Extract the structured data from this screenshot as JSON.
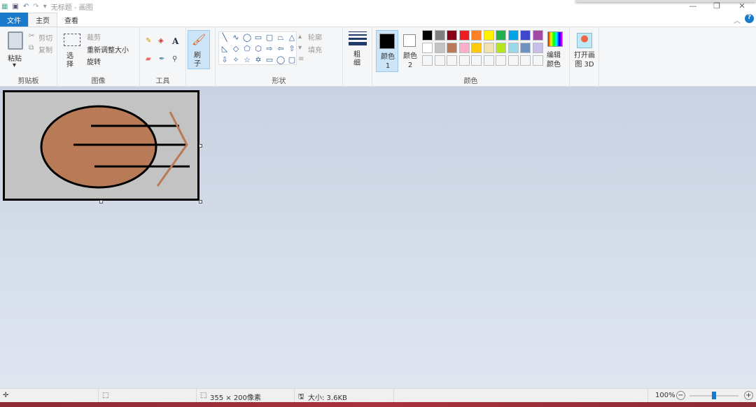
{
  "titlebar": {
    "title": "无标题 - 画图",
    "icons": [
      "paint-app-icon",
      "save-icon",
      "undo-icon",
      "redo-icon",
      "customize-dropdown-icon"
    ]
  },
  "window_controls": {
    "minimize": "—",
    "restore": "❐",
    "close": "✕"
  },
  "tabs": [
    {
      "label": "文件"
    },
    {
      "label": "主页"
    },
    {
      "label": "查看"
    }
  ],
  "ribbon": {
    "clipboard": {
      "label": "剪贴板",
      "paste": "粘贴",
      "cut": "剪切",
      "copy": "复制"
    },
    "image": {
      "label": "图像",
      "select": "选择",
      "crop": "裁剪",
      "resize": "重新调整大小",
      "rotate": "旋转"
    },
    "tools": {
      "label": "工具"
    },
    "brush": {
      "label": "刷子"
    },
    "shapes": {
      "label": "形状",
      "outline": "轮廓",
      "fill": "填充",
      "glyphs": [
        "╲",
        "∿",
        "◯",
        "▭",
        "▢",
        "⏢",
        "△",
        "◺",
        "◇",
        "⬠",
        "⬡",
        "⇨",
        "⇦",
        "⇧",
        "⇩",
        "✧",
        "☆",
        "✡",
        "▭",
        "◯",
        "▢"
      ]
    },
    "size": {
      "label": "粗细"
    },
    "colors": {
      "label": "颜色",
      "color1": "颜色 1",
      "color2": "颜色 2",
      "edit": "编辑颜色",
      "color1_value": "#000000",
      "color2_value": "#ffffff",
      "palette_row1": [
        "#000000",
        "#7f7f7f",
        "#880015",
        "#ed1c24",
        "#ff7f27",
        "#fff200",
        "#22b14c",
        "#00a2e8",
        "#3f48cc",
        "#a349a4"
      ],
      "palette_row2": [
        "#ffffff",
        "#c3c3c3",
        "#b97a57",
        "#ffaec9",
        "#ffc90e",
        "#efe4b0",
        "#b5e61d",
        "#99d9ea",
        "#7092be",
        "#c8bfe7"
      ]
    },
    "paint3d": {
      "label": "打开画图 3D"
    }
  },
  "canvas": {
    "background": "#c3c3c3",
    "ellipse_fill": "#b97a57",
    "stroke": "#000000",
    "chevron_color": "#b97a57"
  },
  "status": {
    "dimensions": "355 × 200像素",
    "size": "大小: 3.6KB",
    "zoom": "100%",
    "zoom_percent": 100
  }
}
